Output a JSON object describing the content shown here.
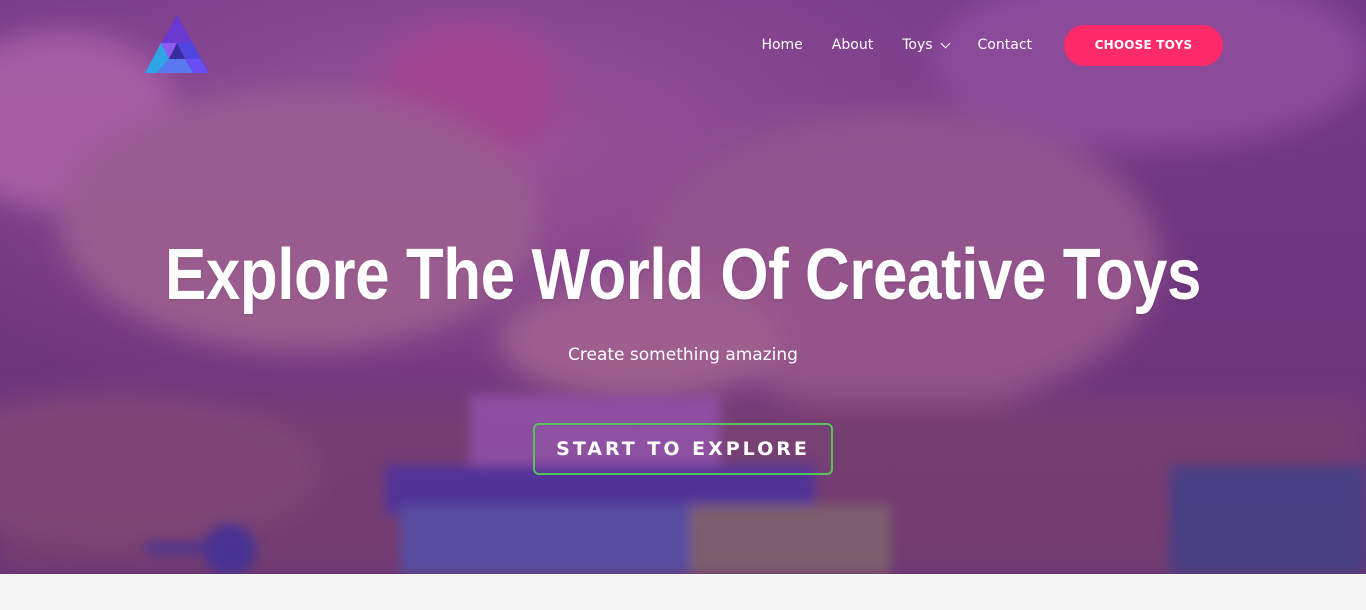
{
  "header": {
    "logo_icon": "triangle-blocks-logo-icon",
    "nav": [
      {
        "label": "Home"
      },
      {
        "label": "About"
      },
      {
        "label": "Toys",
        "has_dropdown": true
      },
      {
        "label": "Contact"
      }
    ],
    "cta_label": "CHOOSE TOYS"
  },
  "hero": {
    "headline": "Explore The World Of Creative Toys",
    "subheadline": "Create something amazing",
    "button_label": "START TO EXPLORE"
  },
  "colors": {
    "accent": "#ff2a6a",
    "button_border": "#56c35a",
    "overlay": "#7a3a8c",
    "text": "#ffffff"
  }
}
